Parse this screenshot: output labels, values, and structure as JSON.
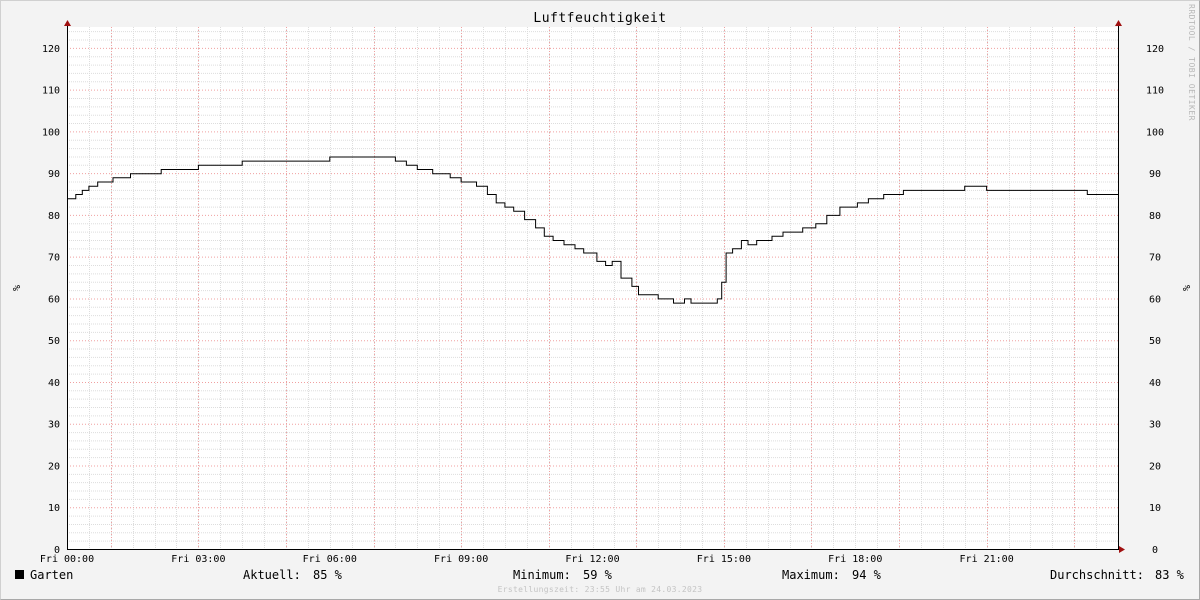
{
  "chart_data": {
    "type": "line",
    "title": "Luftfeuchtigkeit",
    "ylabel": "%",
    "ylim": [
      0,
      125
    ],
    "y_ticks": [
      0,
      10,
      20,
      30,
      40,
      50,
      60,
      70,
      80,
      90,
      100,
      110,
      120
    ],
    "x_tick_labels": [
      "Fri 00:00",
      "Fri 03:00",
      "Fri 06:00",
      "Fri 09:00",
      "Fri 12:00",
      "Fri 15:00",
      "Fri 18:00",
      "Fri 21:00"
    ],
    "x_unit": "hour",
    "xlim": [
      0,
      24
    ],
    "grid": true,
    "series": [
      {
        "name": "Garten",
        "color": "#000000",
        "x": [
          0,
          0.2,
          0.35,
          0.5,
          0.7,
          0.9,
          1.05,
          1.45,
          2.15,
          3.0,
          4.0,
          6.0,
          7.5,
          7.75,
          8.0,
          8.35,
          8.75,
          9.0,
          9.35,
          9.6,
          9.8,
          10.0,
          10.2,
          10.45,
          10.7,
          10.9,
          11.1,
          11.35,
          11.6,
          11.8,
          12.1,
          12.3,
          12.45,
          12.65,
          12.9,
          13.05,
          13.5,
          13.85,
          14.1,
          14.25,
          14.85,
          14.95,
          15.05,
          15.2,
          15.4,
          15.55,
          15.75,
          16.1,
          16.35,
          16.8,
          17.1,
          17.35,
          17.65,
          18.05,
          18.3,
          18.65,
          19.1,
          20.5,
          21.0,
          23.3,
          24.0
        ],
        "values": [
          84,
          85,
          86,
          87,
          88,
          88,
          89,
          90,
          91,
          92,
          93,
          94,
          93,
          92,
          91,
          90,
          89,
          88,
          87,
          85,
          83,
          82,
          81,
          79,
          77,
          75,
          74,
          73,
          72,
          71,
          69,
          68,
          69,
          65,
          63,
          61,
          60,
          59,
          60,
          59,
          60,
          64,
          71,
          72,
          74,
          73,
          74,
          75,
          76,
          77,
          78,
          80,
          82,
          83,
          84,
          85,
          86,
          87,
          86,
          85,
          85
        ]
      }
    ],
    "legend": {
      "name": "Garten",
      "stats": [
        {
          "label": "Aktuell:",
          "value": "85 %"
        },
        {
          "label": "Minimum:",
          "value": "59 %"
        },
        {
          "label": "Maximum:",
          "value": "94 %"
        },
        {
          "label": "Durchschnitt:",
          "value": "83 %"
        }
      ]
    }
  },
  "watermark": "RRDTOOL / TOBI OETIKER",
  "footer": "Erstellungszeit: 23:55 Uhr am 24.03.2023"
}
